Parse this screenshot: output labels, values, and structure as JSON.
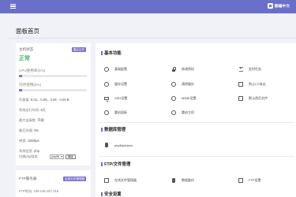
{
  "header": {
    "brand": "图编中文"
  },
  "page": {
    "title": "面板首页"
  },
  "status_card": {
    "title": "主机状态",
    "badge": "重启主机",
    "status": "正常",
    "cpu_label": "CPU使用率(5%)",
    "cpu_usage": 0.05,
    "mem_label": "内存使用(5%)",
    "mem_usage": 0.05,
    "kv": [
      {
        "label": "负载值:",
        "value": "0.02，0.09，0.05 · 0.00 B"
      },
      {
        "label": "系统运行时间:",
        "value": "5天"
      },
      {
        "label": "最大连接数:",
        "value": "不限"
      },
      {
        "label": "最后测速:",
        "value": "0%"
      },
      {
        "label": "带宽:",
        "value": "10Mbps"
      },
      {
        "label": "系统信息:",
        "value": "php"
      }
    ],
    "php_label": "切换php版本:",
    "php_selected": "php56",
    "php_button": "确定"
  },
  "ftp_card": {
    "title": "FTP服务器",
    "button": "启用文件管理器",
    "address_label": "FTP地址:",
    "address_value": "106.126.157.215"
  },
  "main": {
    "sections": [
      {
        "title": "基本功能",
        "tools": [
          {
            "label": "基础配置",
            "icon": "circle-icon"
          },
          {
            "label": "修改密码",
            "icon": "lock-icon"
          },
          {
            "label": "定时任务",
            "icon": "hourglass-icon"
          },
          {
            "label": "缓存设置",
            "icon": "circle-icon"
          },
          {
            "label": "清除缓存",
            "icon": "circle-icon"
          },
          {
            "label": "防止CC攻击",
            "icon": "square-icon"
          },
          {
            "label": "SSH设置",
            "icon": "monitor-icon"
          },
          {
            "label": "MIME设置",
            "icon": "circle-icon"
          },
          {
            "label": "默认首页文件",
            "icon": "square-icon"
          },
          {
            "label": "重启面板",
            "icon": "circle-icon"
          },
          {
            "label": "重启主机",
            "icon": "circle-icon"
          }
        ]
      },
      {
        "title": "数据库管理",
        "tools": [
          {
            "label": "phpMyAdmin",
            "icon": "database-icon"
          }
        ]
      },
      {
        "title": "FTP/文件管理",
        "tools": [
          {
            "label": "在线文件管理器",
            "icon": "square-icon"
          },
          {
            "label": "数据备份",
            "icon": "database-icon"
          },
          {
            "label": "FTP设置",
            "icon": "square-icon"
          }
        ]
      },
      {
        "title": "安全设置",
        "tools": []
      }
    ]
  }
}
